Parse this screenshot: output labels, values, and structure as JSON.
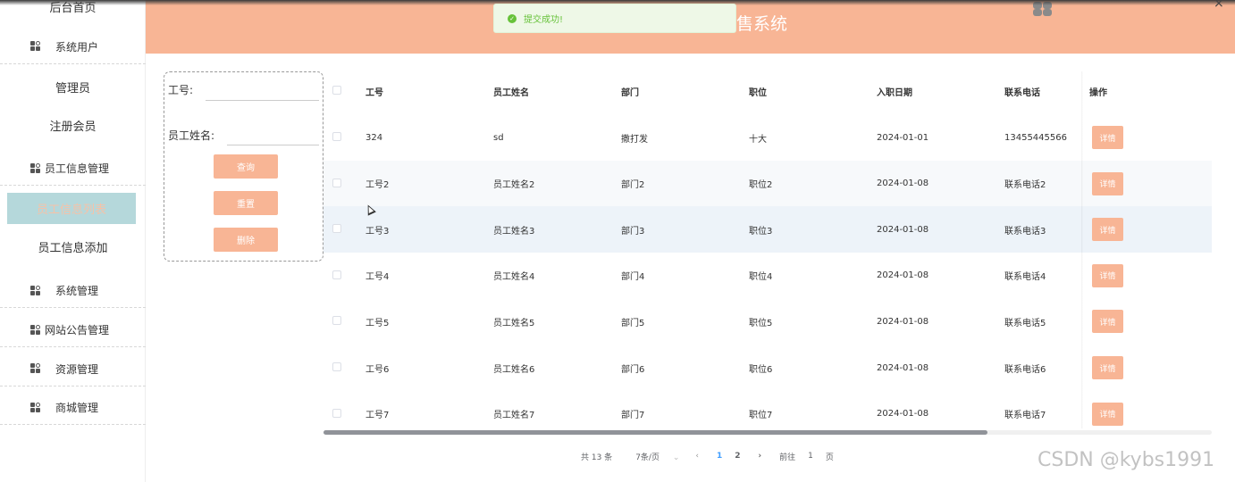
{
  "topbar": {
    "partial_text": "...",
    "close_glyph": "×"
  },
  "header": {
    "title": "售系统",
    "accent": "#f8b595"
  },
  "toast": {
    "message": "提交成功!",
    "color": "#67c23a"
  },
  "sidebar": {
    "top_item": "后台首页",
    "groups": [
      {
        "label": "系统用户"
      },
      {
        "label": "员工信息管理"
      },
      {
        "label": "系统管理"
      },
      {
        "label": "网站公告管理"
      },
      {
        "label": "资源管理"
      },
      {
        "label": "商城管理"
      }
    ],
    "sub_items": [
      "管理员",
      "注册会员",
      "员工信息列表",
      "员工信息添加"
    ]
  },
  "search": {
    "fields": [
      {
        "label": "工号:",
        "value": ""
      },
      {
        "label": "员工姓名:",
        "value": ""
      }
    ],
    "buttons": [
      "查询",
      "重置",
      "删除"
    ]
  },
  "table": {
    "columns": [
      "工号",
      "员工姓名",
      "部门",
      "职位",
      "入职日期",
      "联系电话",
      "操作"
    ],
    "rows": [
      {
        "id": "324",
        "name": "sd",
        "dept": "撒打发",
        "pos": "十大",
        "date": "2024-01-01",
        "phone": "13455445566"
      },
      {
        "id": "工号2",
        "name": "员工姓名2",
        "dept": "部门2",
        "pos": "职位2",
        "date": "2024-01-08",
        "phone": "联系电话2"
      },
      {
        "id": "工号3",
        "name": "员工姓名3",
        "dept": "部门3",
        "pos": "职位3",
        "date": "2024-01-08",
        "phone": "联系电话3"
      },
      {
        "id": "工号4",
        "name": "员工姓名4",
        "dept": "部门4",
        "pos": "职位4",
        "date": "2024-01-08",
        "phone": "联系电话4"
      },
      {
        "id": "工号5",
        "name": "员工姓名5",
        "dept": "部门5",
        "pos": "职位5",
        "date": "2024-01-08",
        "phone": "联系电话5"
      },
      {
        "id": "工号6",
        "name": "员工姓名6",
        "dept": "部门6",
        "pos": "职位6",
        "date": "2024-01-08",
        "phone": "联系电话6"
      },
      {
        "id": "工号7",
        "name": "员工姓名7",
        "dept": "部门7",
        "pos": "职位7",
        "date": "2024-01-08",
        "phone": "联系电话7"
      }
    ],
    "detail_label": "详情"
  },
  "pagination": {
    "total": "共 13 条",
    "page_size": "7条/页",
    "pages": [
      "1",
      "2"
    ],
    "current": "1",
    "goto_prefix": "前往",
    "goto_value": "1",
    "goto_suffix": "页"
  },
  "watermark": "CSDN @kybs1991"
}
